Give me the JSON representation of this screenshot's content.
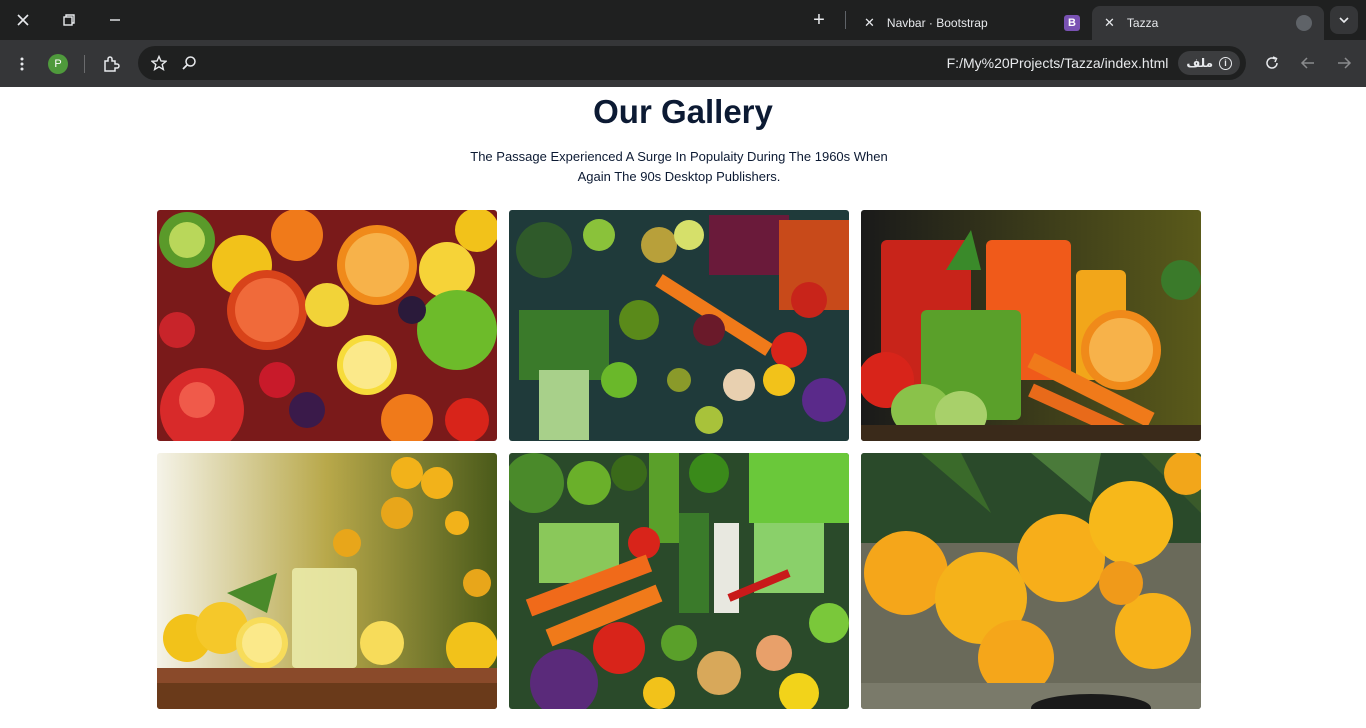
{
  "browser": {
    "tabs": [
      {
        "title": "Navbar · Bootstrap",
        "favicon": "bootstrap-icon",
        "active": false
      },
      {
        "title": "Tazza",
        "favicon": "globe-icon",
        "active": true
      }
    ],
    "profile_initial": "P",
    "url": "F:/My%20Projects/Tazza/index.html",
    "chip_label": "ملف",
    "colors": {
      "chrome_dark": "#1f2020",
      "chrome_toolbar": "#353638",
      "profile": "#4f9a3c",
      "bootstrap": "#7952b3"
    }
  },
  "gallery": {
    "title": "Our Gallery",
    "description": "The Passage Experienced A Surge In Populaity During The 1960s When Again The 90s Desktop Publishers.",
    "text_color": "#0c1a33",
    "images": [
      {
        "name": "gallery-image-fruits"
      },
      {
        "name": "gallery-image-vegetables-colorful"
      },
      {
        "name": "gallery-image-juices"
      },
      {
        "name": "gallery-image-lemonade"
      },
      {
        "name": "gallery-image-vegetables-mix"
      },
      {
        "name": "gallery-image-oranges-tree"
      }
    ]
  }
}
